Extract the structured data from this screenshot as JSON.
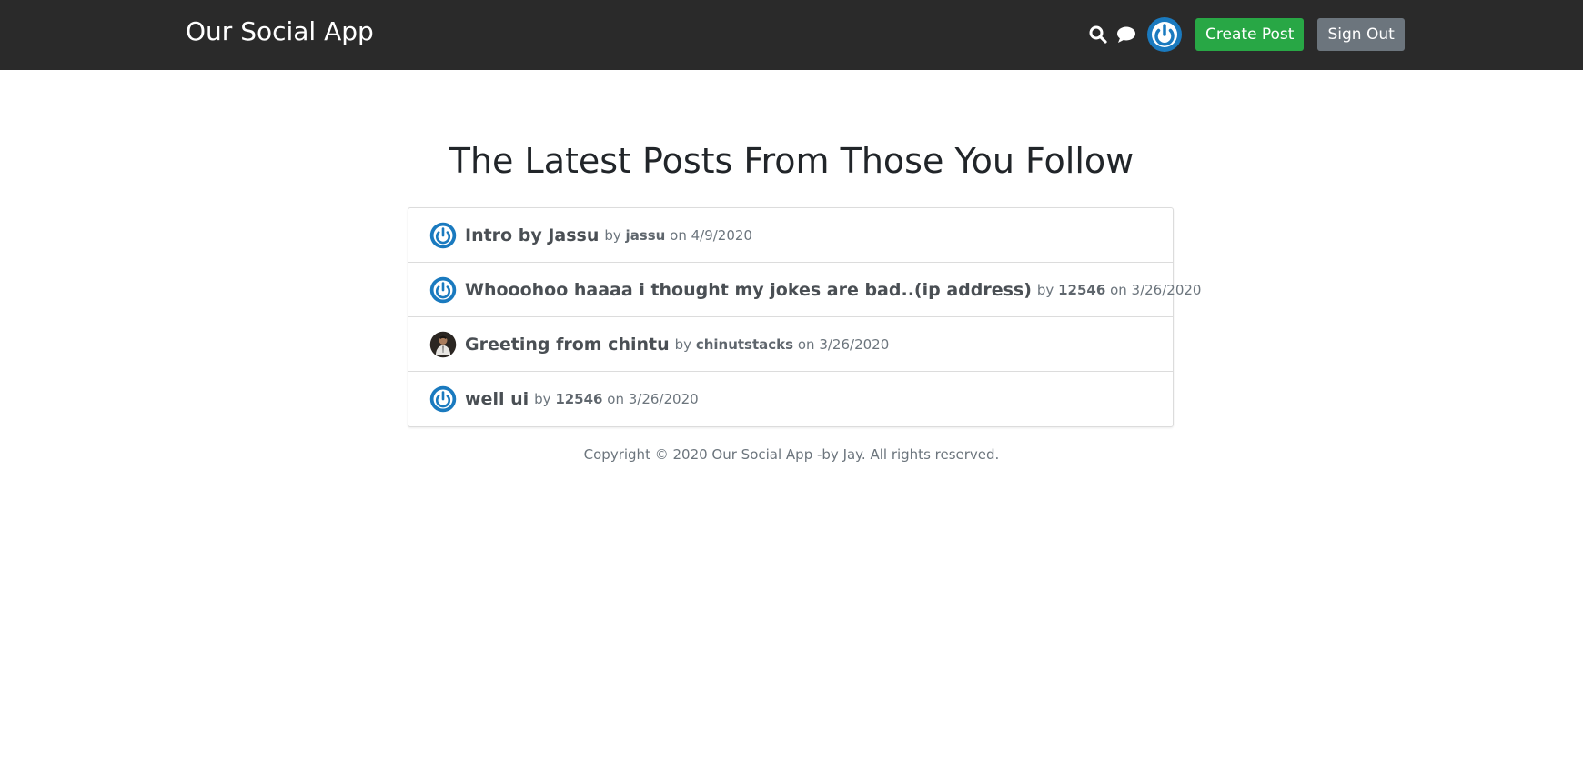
{
  "header": {
    "brand": "Our Social App",
    "create_post_label": "Create Post",
    "sign_out_label": "Sign Out",
    "icons": [
      "search-icon",
      "chat-icon",
      "avatar"
    ],
    "colors": {
      "navbar_bg": "#2a2a2a",
      "create_post_bg": "#28a745",
      "sign_out_bg": "#6c757d",
      "avatar_blue": "#1a7abf"
    }
  },
  "main": {
    "title": "The Latest Posts From Those You Follow",
    "posts": [
      {
        "title": "Intro by Jassu",
        "by": "by",
        "author": "jassu",
        "on": "on",
        "date": "4/9/2020",
        "avatar": "default-power-avatar"
      },
      {
        "title": "Whooohoo haaaa i thought my jokes are bad..(ip address)",
        "by": "by",
        "author": "12546",
        "on": "on",
        "date": "3/26/2020",
        "avatar": "default-power-avatar"
      },
      {
        "title": "Greeting from chintu",
        "by": "by",
        "author": "chinutstacks",
        "on": "on",
        "date": "3/26/2020",
        "avatar": "photo-avatar"
      },
      {
        "title": "well ui",
        "by": "by",
        "author": "12546",
        "on": "on",
        "date": "3/26/2020",
        "avatar": "default-power-avatar"
      }
    ]
  },
  "footer": {
    "text": "Copyright © 2020 Our Social App -by Jay. All rights reserved."
  }
}
